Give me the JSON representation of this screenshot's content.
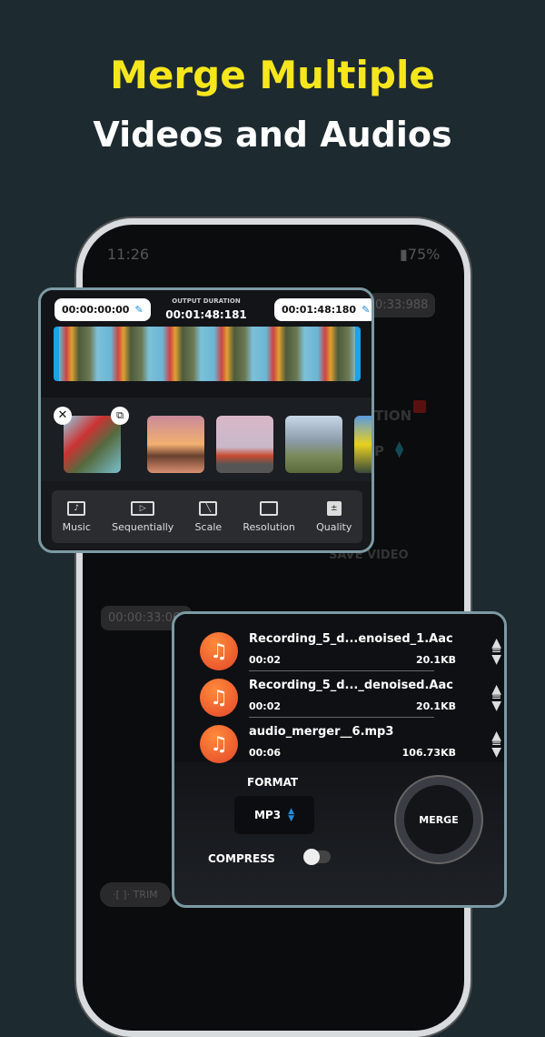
{
  "headline": {
    "line1": "Merge Multiple",
    "line2": "Videos and Audios"
  },
  "status_bar": {
    "time": "11:26",
    "battery": "75%"
  },
  "background_app": {
    "end_time": "0:33:988",
    "label_tion": "TION",
    "label_p": "P",
    "save_video": "SAVE VIDEO",
    "start_time": "00:00:33:064",
    "trim": "TRIM"
  },
  "video_card": {
    "start_time": "00:00:00:00",
    "end_time": "00:01:48:180",
    "output_label": "OUTPUT DURATION",
    "output_value": "00:01:48:181",
    "tools": [
      {
        "label": "Music",
        "icon": "music-note"
      },
      {
        "label": "Sequentially",
        "icon": "sequence"
      },
      {
        "label": "Scale",
        "icon": "scale"
      },
      {
        "label": "Resolution",
        "icon": "resolution"
      },
      {
        "label": "Quality",
        "icon": "quality"
      }
    ]
  },
  "audio_card": {
    "files": [
      {
        "name": "Recording_5_d...enoised_1.Aac",
        "duration": "00:02",
        "size": "20.1KB"
      },
      {
        "name": "Recording_5_d..._denoised.Aac",
        "duration": "00:02",
        "size": "20.1KB"
      },
      {
        "name": "audio_merger__6.mp3",
        "duration": "00:06",
        "size": "106.73KB"
      }
    ],
    "format_label": "FORMAT",
    "format_value": "MP3",
    "compress_label": "COMPRESS",
    "compress_on": false,
    "merge_label": "MERGE"
  },
  "colors": {
    "headline": "#f6e61c",
    "accent": "#1e8de0",
    "card_border": "#7c9aa3",
    "audio_icon": "#e2472a"
  }
}
